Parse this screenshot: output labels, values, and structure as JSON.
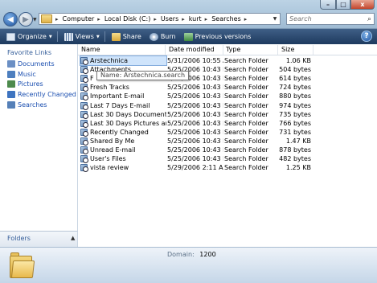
{
  "window": {
    "min_glyph": "–",
    "max_glyph": "□",
    "close_glyph": "x"
  },
  "nav": {
    "back_glyph": "◀",
    "forward_glyph": "▶"
  },
  "address": {
    "crumbs": [
      "Computer",
      "Local Disk (C:)",
      "Users",
      "kurt",
      "Searches"
    ]
  },
  "search": {
    "placeholder": "Search"
  },
  "toolbar": {
    "organize": "Organize",
    "views": "Views",
    "share": "Share",
    "burn": "Burn",
    "previous_versions": "Previous versions",
    "help_glyph": "?"
  },
  "navpane": {
    "title": "Favorite Links",
    "links": [
      {
        "label": "Documents",
        "icon": "documents-icon",
        "color": "#6b8fc4"
      },
      {
        "label": "Music",
        "icon": "music-icon",
        "color": "#4e7fbf"
      },
      {
        "label": "Pictures",
        "icon": "pictures-icon",
        "color": "#4d8a4d"
      },
      {
        "label": "Recently Changed",
        "icon": "recently-changed-icon",
        "color": "#3e74c0"
      },
      {
        "label": "Searches",
        "icon": "searches-icon",
        "color": "#5580b8"
      }
    ],
    "folders_label": "Folders",
    "folders_chevron": "▲"
  },
  "columns": {
    "name": "Name",
    "date": "Date modified",
    "type": "Type",
    "size": "Size"
  },
  "files": [
    {
      "name": "Arstechnica",
      "date": "5/31/2006 10:55 AM",
      "type": "Search Folder",
      "size": "1.06 KB"
    },
    {
      "name": "Attachments",
      "date": "5/25/2006 10:43 PM",
      "type": "Search Folder",
      "size": "504 bytes"
    },
    {
      "name": "F",
      "date": "5/25/2006 10:43 PM",
      "type": "Search Folder",
      "size": "614 bytes"
    },
    {
      "name": "Fresh Tracks",
      "date": "5/25/2006 10:43 PM",
      "type": "Search Folder",
      "size": "724 bytes"
    },
    {
      "name": "Important E-mail",
      "date": "5/25/2006 10:43 PM",
      "type": "Search Folder",
      "size": "880 bytes"
    },
    {
      "name": "Last 7 Days E-mail",
      "date": "5/25/2006 10:43 PM",
      "type": "Search Folder",
      "size": "974 bytes"
    },
    {
      "name": "Last 30 Days Documents",
      "date": "5/25/2006 10:43 PM",
      "type": "Search Folder",
      "size": "735 bytes"
    },
    {
      "name": "Last 30 Days Pictures and Vi...",
      "date": "5/25/2006 10:43 PM",
      "type": "Search Folder",
      "size": "766 bytes"
    },
    {
      "name": "Recently Changed",
      "date": "5/25/2006 10:43 PM",
      "type": "Search Folder",
      "size": "731 bytes"
    },
    {
      "name": "Shared By Me",
      "date": "5/25/2006 10:43 PM",
      "type": "Search Folder",
      "size": "1.47 KB"
    },
    {
      "name": "Unread E-mail",
      "date": "5/25/2006 10:43 PM",
      "type": "Search Folder",
      "size": "878 bytes"
    },
    {
      "name": "User's Files",
      "date": "5/25/2006 10:43 PM",
      "type": "Search Folder",
      "size": "482 bytes"
    },
    {
      "name": "vista review",
      "date": "5/29/2006 2:11 AM",
      "type": "Search Folder",
      "size": "1.25 KB"
    }
  ],
  "tooltip": {
    "text": "Name: Arstechnica.search"
  },
  "details": {
    "domain_label": "Domain:",
    "domain_value": "1200"
  },
  "colors": {
    "accent": "#1b4fb0",
    "selection": "#cfe4fb"
  }
}
